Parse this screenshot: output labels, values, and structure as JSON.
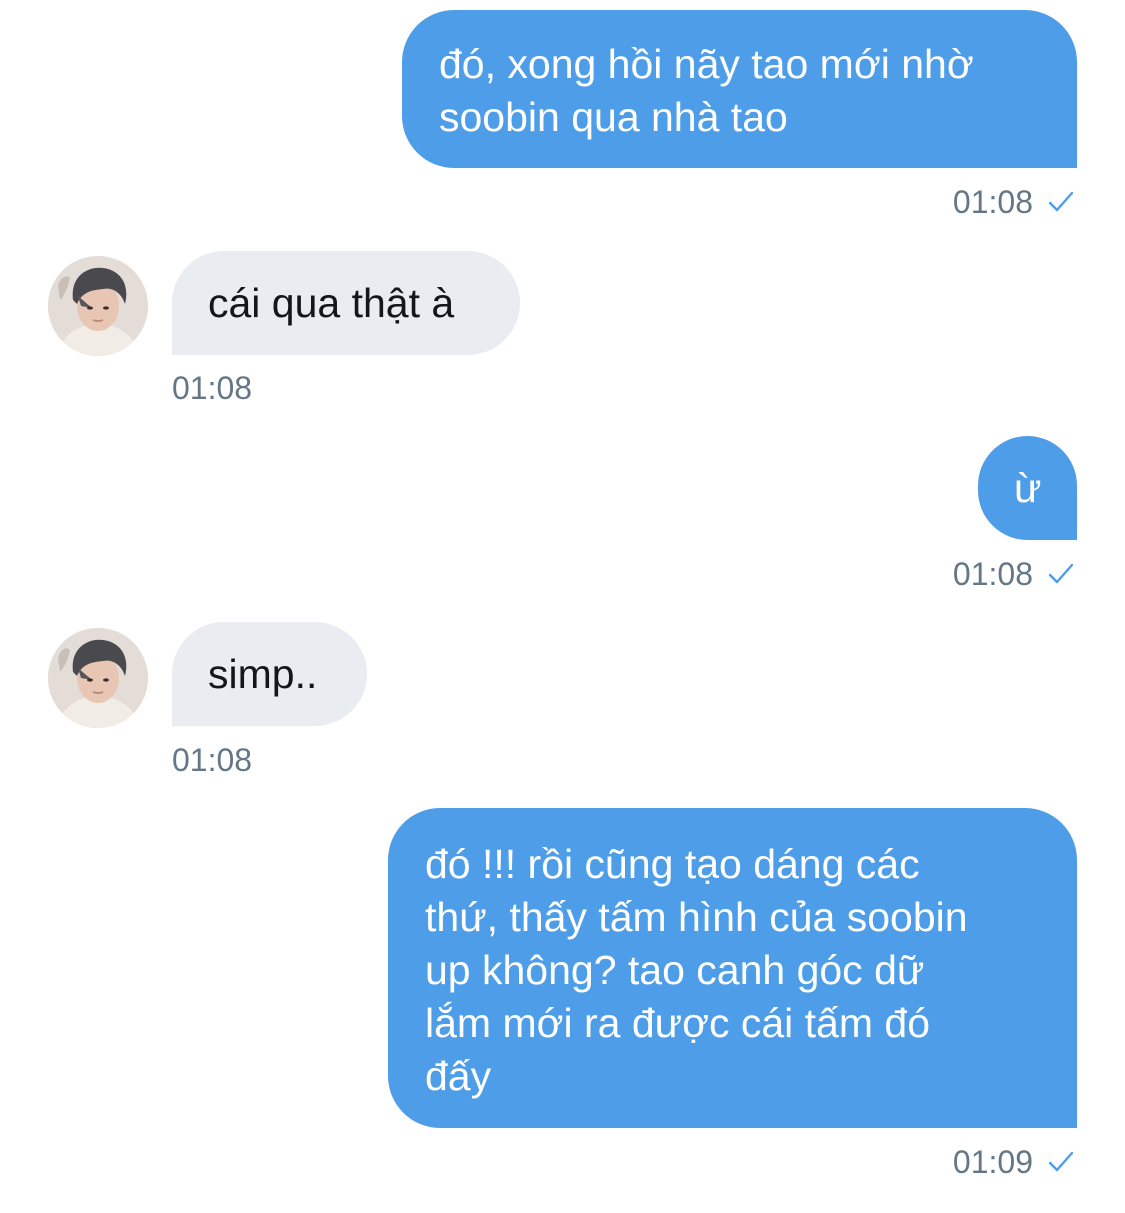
{
  "colors": {
    "outgoing_bubble": "#4e9de8",
    "incoming_bubble": "#e9ecf1",
    "timestamp": "#657786",
    "read_check": "#4e9de8"
  },
  "messages": [
    {
      "direction": "outgoing",
      "text": "đó, xong hồi nãy tao mới nhờ\nsoobin qua nhà tao",
      "time": "01:08",
      "status_icon": "check-icon"
    },
    {
      "direction": "incoming",
      "text": "cái qua thật à",
      "time": "01:08",
      "avatar_icon": "avatar"
    },
    {
      "direction": "outgoing",
      "text": "ừ",
      "time": "01:08",
      "status_icon": "check-icon"
    },
    {
      "direction": "incoming",
      "text": "simp..",
      "time": "01:08",
      "avatar_icon": "avatar"
    },
    {
      "direction": "outgoing",
      "text": "đó !!! rồi cũng tạo dáng các\nthứ, thấy tấm hình của soobin\nup không? tao canh góc dữ\nlắm mới ra được cái tấm đó\nđấy",
      "time": "01:09",
      "status_icon": "check-icon"
    }
  ]
}
